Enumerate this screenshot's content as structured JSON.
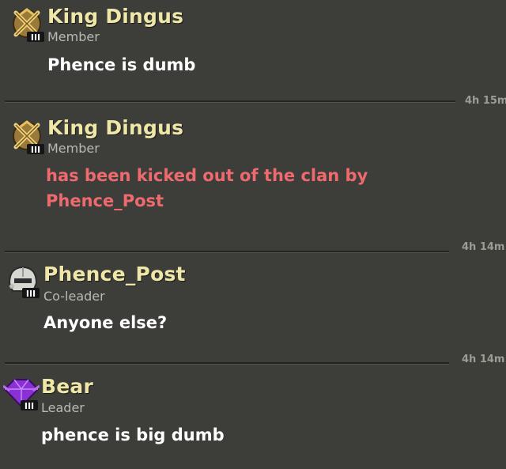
{
  "messages": [
    {
      "name": "King Dingus",
      "role": "Member",
      "text": "Phence is dumb",
      "time": "4h 15m",
      "badge": "crossed-swords-gold-icon"
    },
    {
      "name": "King Dingus",
      "role": "Member",
      "text_line1": "has been kicked out of the clan by",
      "text_line2": "Phence_Post",
      "time": "4h 14m",
      "badge": "crossed-swords-gold-icon"
    },
    {
      "name": "Phence_Post",
      "role": "Co-leader",
      "text": "Anyone else?",
      "time": "4h 14m",
      "badge": "helmet-silver-icon"
    },
    {
      "name": "Bear",
      "role": "Leader",
      "text": "phence is big dumb",
      "badge": "purple-gem-icon"
    }
  ],
  "badge_level": "III",
  "colors": {
    "background": "#3d3e3a",
    "name": "#efe7a8",
    "role": "#b9b9b4",
    "message": "#ffffff",
    "system_message": "#ee6a6e"
  }
}
